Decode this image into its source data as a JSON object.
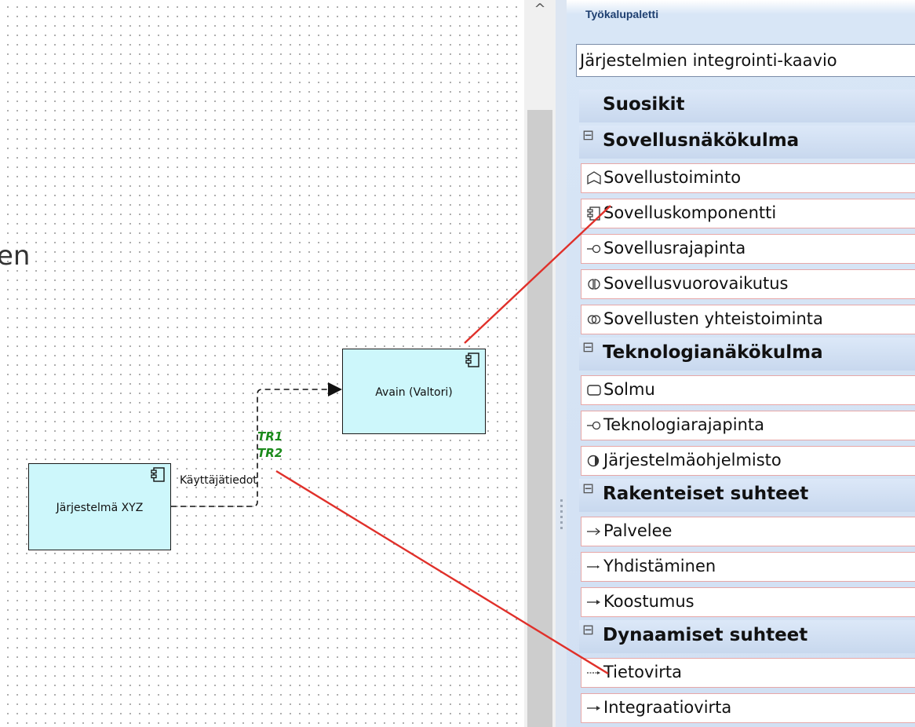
{
  "canvas": {
    "partial_text": "en",
    "elements": [
      {
        "name": "Järjestelmä XYZ",
        "icon": "component-icon"
      },
      {
        "name": "Avain (Valtori)",
        "icon": "component-icon"
      }
    ],
    "flow_label": "Käyttäjätiedot",
    "tr_labels": [
      "TR1",
      "TR2"
    ],
    "colors": {
      "element_fill": "#cdf7fb",
      "annotation_arrow": "#e0302a",
      "tr_label": "#1b8a1b"
    }
  },
  "scrollbar": {
    "up_arrow": "^"
  },
  "toolbox": {
    "title": "Työkalupaletti",
    "selected_diagram": "Järjestelmien integrointi-kaavio",
    "favorites": "Suosikit",
    "groups": [
      {
        "label": "Sovellusnäkökulma",
        "expander": "⊟",
        "items": [
          {
            "label": "Sovellustoiminto",
            "icon": "application-function-icon"
          },
          {
            "label": "Sovelluskomponentti",
            "icon": "application-component-icon"
          },
          {
            "label": "Sovellusrajapinta",
            "icon": "application-interface-icon"
          },
          {
            "label": "Sovellusvuorovaikutus",
            "icon": "application-interaction-icon"
          },
          {
            "label": "Sovellusten yhteistoiminta",
            "icon": "application-collaboration-icon"
          }
        ]
      },
      {
        "label": "Teknologianäkökulma",
        "expander": "⊟",
        "items": [
          {
            "label": "Solmu",
            "icon": "node-icon"
          },
          {
            "label": "Teknologiarajapinta",
            "icon": "technology-interface-icon"
          },
          {
            "label": "Järjestelmäohjelmisto",
            "icon": "system-software-icon"
          }
        ]
      },
      {
        "label": "Rakenteiset suhteet",
        "expander": "⊟",
        "items": [
          {
            "label": "Palvelee",
            "icon": "serving-arrow-icon"
          },
          {
            "label": "Yhdistäminen",
            "icon": "association-arrow-icon"
          },
          {
            "label": "Koostumus",
            "icon": "composition-arrow-icon"
          }
        ]
      },
      {
        "label": "Dynaamiset suhteet",
        "expander": "⊟",
        "items": [
          {
            "label": "Tietovirta",
            "icon": "flow-arrow-icon"
          },
          {
            "label": "Integraatiovirta",
            "icon": "integration-flow-arrow-icon"
          }
        ]
      }
    ]
  }
}
